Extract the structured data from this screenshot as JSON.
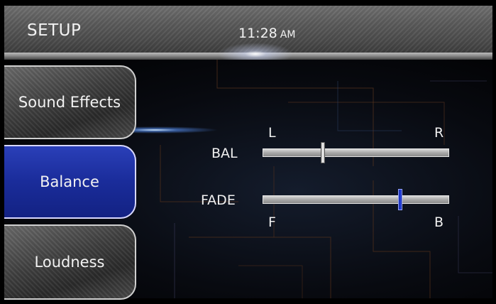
{
  "header": {
    "title": "SETUP",
    "time": "11:28",
    "ampm": "AM"
  },
  "menu": {
    "items": [
      {
        "label": "Sound Effects",
        "selected": false
      },
      {
        "label": "Balance",
        "selected": true
      },
      {
        "label": "Loudness",
        "selected": false
      }
    ]
  },
  "balance": {
    "label": "BAL",
    "left_label": "L",
    "right_label": "R",
    "value": 0.32
  },
  "fade": {
    "label": "FADE",
    "front_label": "F",
    "back_label": "B",
    "value": 0.74
  },
  "colors": {
    "accent": "#1f33a8",
    "header": "#5a5a5a",
    "background": "#000000"
  }
}
